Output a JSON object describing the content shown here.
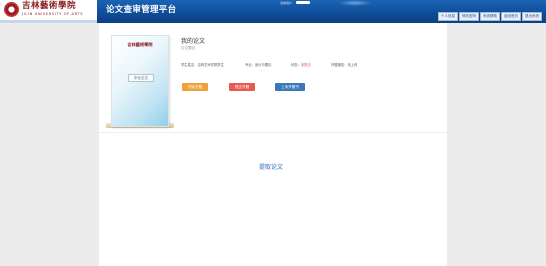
{
  "header": {
    "logo_cn": "吉林藝術學院",
    "logo_en": "JILIN UNIVERSITY OF ARTS",
    "app_title": "论文查审管理平台",
    "mini_label": "当前用户",
    "nav": [
      "个人信息",
      "修改密码",
      "系统帮助",
      "返回首页",
      "退出系统"
    ]
  },
  "thesis": {
    "book_school": "吉林藝術學院",
    "book_badge": "毕业论文",
    "title": "我的论文",
    "subtitle": "论文题目",
    "meta": [
      {
        "label": "学生姓名：",
        "value": "吉林艺术学院学生"
      },
      {
        "label": "专业：",
        "value": "设计与理论"
      },
      {
        "label": "状态：",
        "value": "未提交"
      },
      {
        "label": "开题报告：",
        "value": "未上传"
      }
    ],
    "actions": {
      "start": "开始开题",
      "submit": "提交开题",
      "upload": "上传开题书"
    },
    "extract_label": "提取论文"
  },
  "colors": {
    "header": "#0f4c98",
    "start_btn": "#f0a13a",
    "submit_btn": "#e85a4f",
    "upload_btn": "#3a78b8",
    "link": "#2a6fb6"
  }
}
